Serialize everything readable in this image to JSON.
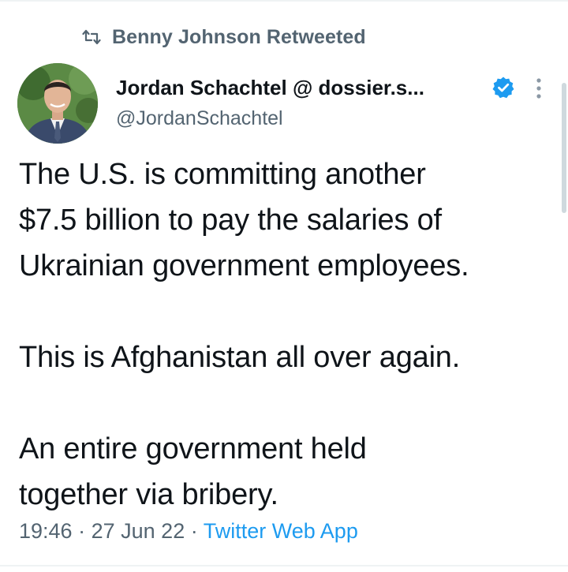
{
  "retweet_banner": {
    "icon": "retweet-icon",
    "text": "Benny Johnson Retweeted"
  },
  "author": {
    "display_name": "Jordan Schachtel @ dossier.s...",
    "handle": "@JordanSchachtel",
    "verified": true,
    "verified_icon": "verified-badge-icon",
    "avatar": "profile-photo"
  },
  "tweet": {
    "paragraphs": [
      "The U.S. is committing another\n$7.5 billion to pay the salaries of\nUkrainian government employees.",
      "This is Afghanistan all over again.",
      "An entire government held\ntogether via bribery."
    ],
    "time": "19:46",
    "separator": "·",
    "date": "27 Jun 22",
    "source": "Twitter Web App"
  },
  "colors": {
    "text_primary": "#0f1419",
    "text_secondary": "#536471",
    "accent_blue": "#1d9bf0",
    "divider": "#eff3f4"
  },
  "menu": {
    "icon": "more-options-icon"
  }
}
